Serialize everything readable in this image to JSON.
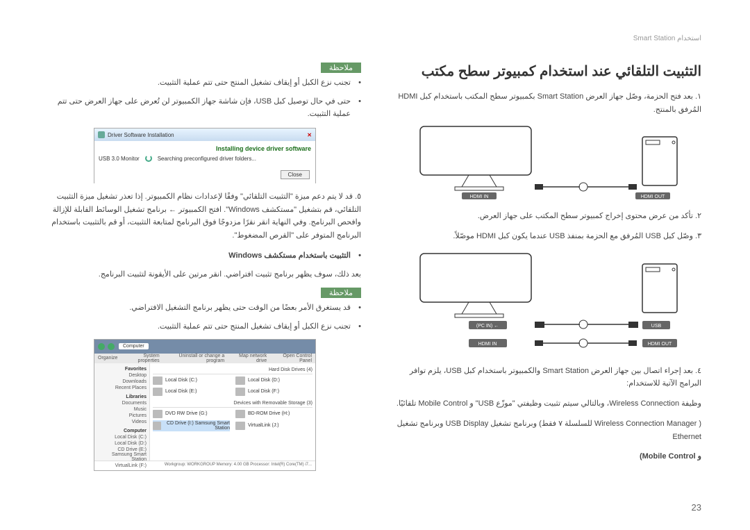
{
  "header": {
    "product": "Smart Station",
    "section": "استخدام"
  },
  "page_number": "23",
  "title": "التثبيت التلقائي عند استخدام كمبيوتر سطح مكتب",
  "steps": {
    "s1": "١. بعد فتح الحزمة، وصّل جهاز العرض Smart Station بكمبيوتر سطح المكتب باستخدام كبل HDMI المُرفق بالمنتج.",
    "s2": "٢. تأكد من عرض محتوى إخراج كمبيوتر سطح المكتب على جهاز العرض.",
    "s3": "٣. وصّل كبل USB المُرفق مع الحزمة بمنفذ USB عندما يكون كبل HDMI موصّلاً.",
    "s4_a": "٤. بعد إجراء اتصال بين جهاز العرض Smart Station والكمبيوتر باستخدام كبل USB، يلزم توافر البرامج الآتية للاستخدام:",
    "s4_b": "وظيفة Wireless Connection، وبالتالي سيتم تثبيت وظيفتي \"موزّع USB\" و Mobile Control تلقائيًا.",
    "s4_c": "( Wireless Connection Manager للسلسلة ٧ فقط) وبرنامج تشغيل USB Display وبرنامج تشغيل Ethernet",
    "s4_d": "و Mobile Control)"
  },
  "notes": {
    "label": "ملاحظة",
    "n1": "تجنب نزع الكبل أو إيقاف تشغيل المنتج حتى تتم عملية التثبيت.",
    "n2": "حتى في حال توصيل كبل USB، فإن شاشة جهاز الكمبيوتر لن تُعرض على جهاز العرض حتى تتم عملية التثبيت.",
    "n5_a": "٥. قد لا يتم دعم ميزة \"التثبيت التلقائي\" وفقًا لإعدادات نظام الكمبيوتر. إذا تعذر تشغيل ميزة التثبيت التلقائي، قم بتشغيل \"مستكشف Windows\". افتح الكمبيوتر ← برنامج تشغيل الوسائط القابلة للإزالة وافحص البرنامج. وفي النهاية انقر نقرًا مزدوجًا فوق البرنامج لمتابعة التثبيت، أو قم بالتثبيت باستخدام البرنامج المتوفر على \"القرص المضغوط\".",
    "n5_b": "التثبيت باستخدام مستكشف Windows",
    "n5_c": "بعد ذلك، سوف يظهر برنامج تثبيت افتراضي. انقر مرتين على الأيقونة لتثبيت البرنامج.",
    "n6": "قد يستغرق الأمر بعضًا من الوقت حتى يظهر برنامج التشغيل الافتراضي.",
    "n7": "تجنب نزع الكبل أو إيقاف تشغيل المنتج حتى تتم عملية التثبيت."
  },
  "diagram_labels": {
    "hdmi_in": "HDMI IN",
    "hdmi_out": "HDMI OUT",
    "usb": "USB",
    "pc_in": "(PC IN)"
  },
  "screenshot1": {
    "title": "Driver Software Installation",
    "main": "Installing device driver software",
    "device": "USB 3.0 Monitor",
    "status": "Searching preconfigured driver folders...",
    "close": "Close"
  },
  "explorer": {
    "breadcrumb": "Computer",
    "toolbar": {
      "organize": "Organize",
      "props": "System properties",
      "uninstall": "Uninstall or change a program",
      "map": "Map network drive",
      "control": "Open Control Panel"
    },
    "sidebar": {
      "fav": "Favorites",
      "desktop": "Desktop",
      "downloads": "Downloads",
      "recent": "Recent Places",
      "lib": "Libraries",
      "docs": "Documents",
      "mus": "Music",
      "pics": "Pictures",
      "vids": "Videos",
      "comp": "Computer",
      "ld_c": "Local Disk (C:)",
      "ld_d": "Local Disk (D:)",
      "cd_e": "CD Drive (E:) Samsung Smart Station",
      "vl_f": "VirtualLink (F:)"
    },
    "sections": {
      "hdd": "Hard Disk Drives (4)",
      "remov": "Devices with Removable Storage (3)"
    },
    "drives": {
      "c": "Local Disk (C:)",
      "d": "Local Disk (D:)",
      "e": "Local Disk (E:)",
      "f": "Local Disk (F:)",
      "dvd": "DVD RW Drive (G:)",
      "bd": "BD-ROM Drive (H:)",
      "smart": "CD Drive (I:) Samsung Smart Station",
      "vlink": "VirtualLink (J:)"
    },
    "status": "Workgroup: WORKGROUP    Memory: 4.00 GB    Processor: Intel(R) Core(TM) i7..."
  }
}
